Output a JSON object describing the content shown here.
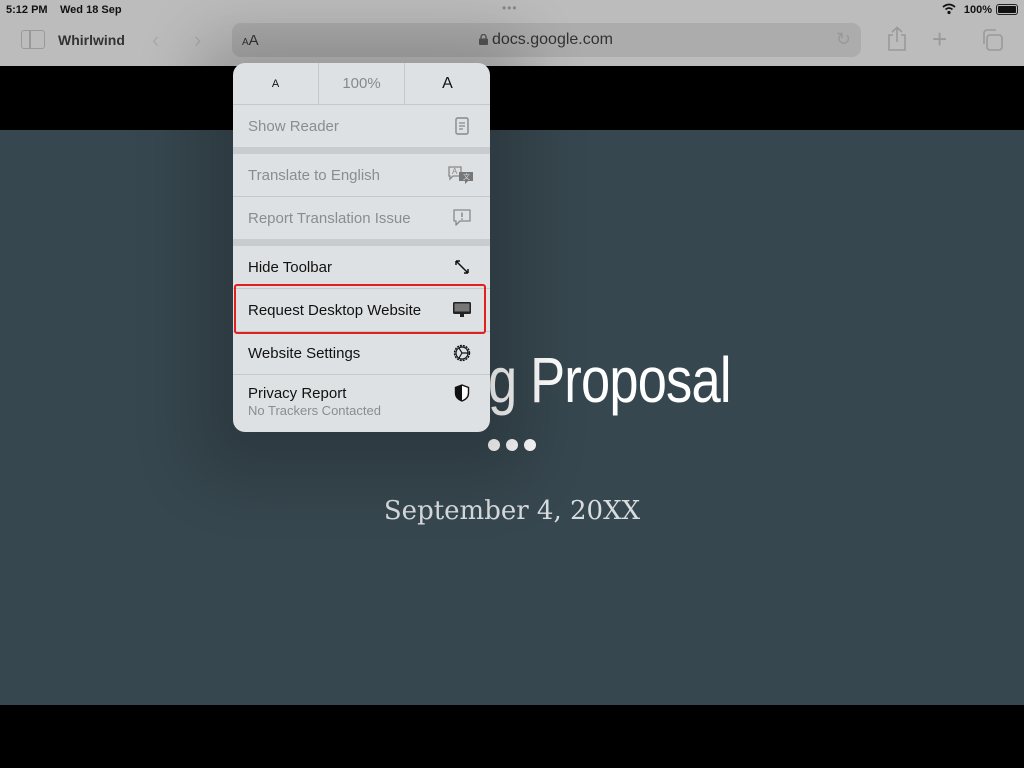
{
  "status_bar": {
    "time": "5:12 PM",
    "date": "Wed 18 Sep",
    "battery": "100%"
  },
  "toolbar": {
    "tab_title": "Whirlwind",
    "text_size_label": "aA",
    "url": "docs.google.com"
  },
  "popover": {
    "font_small": "A",
    "zoom_level": "100%",
    "font_large": "A",
    "items": [
      {
        "label": "Show Reader",
        "icon": "reader-icon",
        "enabled": false
      },
      {
        "label": "Translate to English",
        "icon": "translate-icon",
        "enabled": false
      },
      {
        "label": "Report Translation Issue",
        "icon": "report-issue-icon",
        "enabled": false
      },
      {
        "label": "Hide Toolbar",
        "icon": "resize-arrows-icon",
        "enabled": true
      },
      {
        "label": "Request Desktop Website",
        "icon": "desktop-icon",
        "enabled": true,
        "highlighted": true
      },
      {
        "label": "Website Settings",
        "icon": "gear-icon",
        "enabled": true
      },
      {
        "label": "Privacy Report",
        "sublabel": "No Trackers Contacted",
        "icon": "shield-icon",
        "enabled": true
      }
    ]
  },
  "page": {
    "title_visible": "ng Proposal",
    "date": "September 4, 20XX",
    "background_color": "#37474f"
  },
  "colors": {
    "highlight": "#e0201c"
  }
}
